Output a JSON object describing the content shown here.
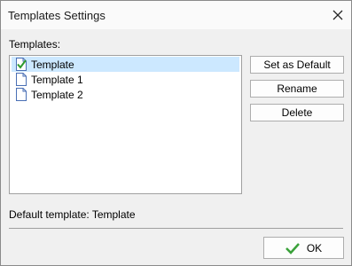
{
  "window": {
    "title": "Templates Settings"
  },
  "templates_label": "Templates:",
  "templates": [
    {
      "name": "Template",
      "icon": "check-document-icon",
      "selected": true
    },
    {
      "name": "Template 1",
      "icon": "document-icon",
      "selected": false
    },
    {
      "name": "Template 2",
      "icon": "document-icon",
      "selected": false
    }
  ],
  "buttons": {
    "set_default": "Set as Default",
    "rename": "Rename",
    "delete": "Delete",
    "ok": "OK"
  },
  "default_template_text": "Default template: Template",
  "colors": {
    "selection": "#cce8ff",
    "check_green": "#3aa13a"
  }
}
